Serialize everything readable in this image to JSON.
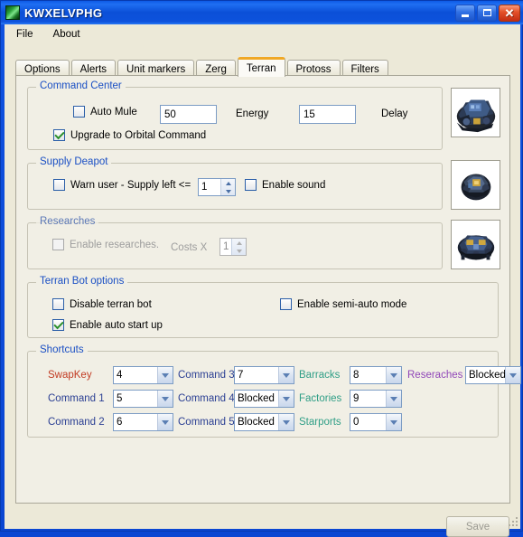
{
  "window": {
    "title": "KWXELVPHG",
    "icon": "app-icon",
    "buttons": {
      "minimize": "_",
      "maximize": "□",
      "close": "✕"
    }
  },
  "menubar": {
    "items": [
      {
        "label": "File"
      },
      {
        "label": "About"
      }
    ]
  },
  "tabs": [
    {
      "label": "Options",
      "active": false
    },
    {
      "label": "Alerts",
      "active": false
    },
    {
      "label": "Unit markers",
      "active": false
    },
    {
      "label": "Zerg",
      "active": false
    },
    {
      "label": "Terran",
      "active": true
    },
    {
      "label": "Protoss",
      "active": false
    },
    {
      "label": "Filters",
      "active": false
    }
  ],
  "command_center": {
    "title": "Command Center",
    "auto_mule": {
      "label": "Auto Mule",
      "checked": false
    },
    "mule_value": "50",
    "energy_label": "Energy",
    "energy_value": "15",
    "delay_label": "Delay",
    "upgrade_orbital": {
      "label": "Upgrade to Orbital Command",
      "checked": true
    }
  },
  "supply_depot": {
    "title": "Supply Deapot",
    "warn_user": {
      "label": "Warn user - Supply left <=",
      "checked": false
    },
    "supply_value": "1",
    "enable_sound": {
      "label": "Enable sound",
      "checked": false
    }
  },
  "researches": {
    "title": "Researches",
    "enable": {
      "label": "Enable researches.",
      "checked": false,
      "disabled": true
    },
    "costs_label": "Costs X",
    "costs_value": "1"
  },
  "terran_bot": {
    "title": "Terran Bot options",
    "disable_bot": {
      "label": "Disable terran bot",
      "checked": false
    },
    "auto_start": {
      "label": "Enable auto start up",
      "checked": true
    },
    "semi_auto": {
      "label": "Enable semi-auto mode",
      "checked": false
    }
  },
  "shortcuts": {
    "title": "Shortcuts",
    "rows": [
      {
        "label": "SwapKey",
        "color": "#c23b22",
        "value": "4",
        "label2": "Command 3",
        "color2": "#2b3f93",
        "value2": "7",
        "label3": "Barracks",
        "color3": "#2f9e86",
        "value3": "8",
        "label4": "Reseraches",
        "color4": "#9046b8",
        "value4": "Blocked"
      },
      {
        "label": "Command 1",
        "color": "#2b3f93",
        "value": "5",
        "label2": "Command 4",
        "color2": "#2b3f93",
        "value2": "Blocked",
        "label3": "Factories",
        "color3": "#2f9e86",
        "value3": "9",
        "label4": "",
        "color4": "#9046b8",
        "value4": ""
      },
      {
        "label": "Command 2",
        "color": "#2b3f93",
        "value": "6",
        "label2": "Command 5",
        "color2": "#2b3f93",
        "value2": "Blocked",
        "label3": "Starports",
        "color3": "#2f9e86",
        "value3": "0",
        "label4": "",
        "color4": "#9046b8",
        "value4": ""
      }
    ]
  },
  "pictures": [
    {
      "name": "command-center-sprite"
    },
    {
      "name": "supply-depot-sprite"
    },
    {
      "name": "engineering-bay-sprite"
    }
  ],
  "footer": {
    "save_label": "Save",
    "save_disabled": true
  },
  "colors": {
    "titlebar": "#0b50d8",
    "client": "#ece9d8",
    "panel": "#f1efe5",
    "group_title": "#1a4fc4",
    "active_tab_accent": "#f0a825"
  }
}
